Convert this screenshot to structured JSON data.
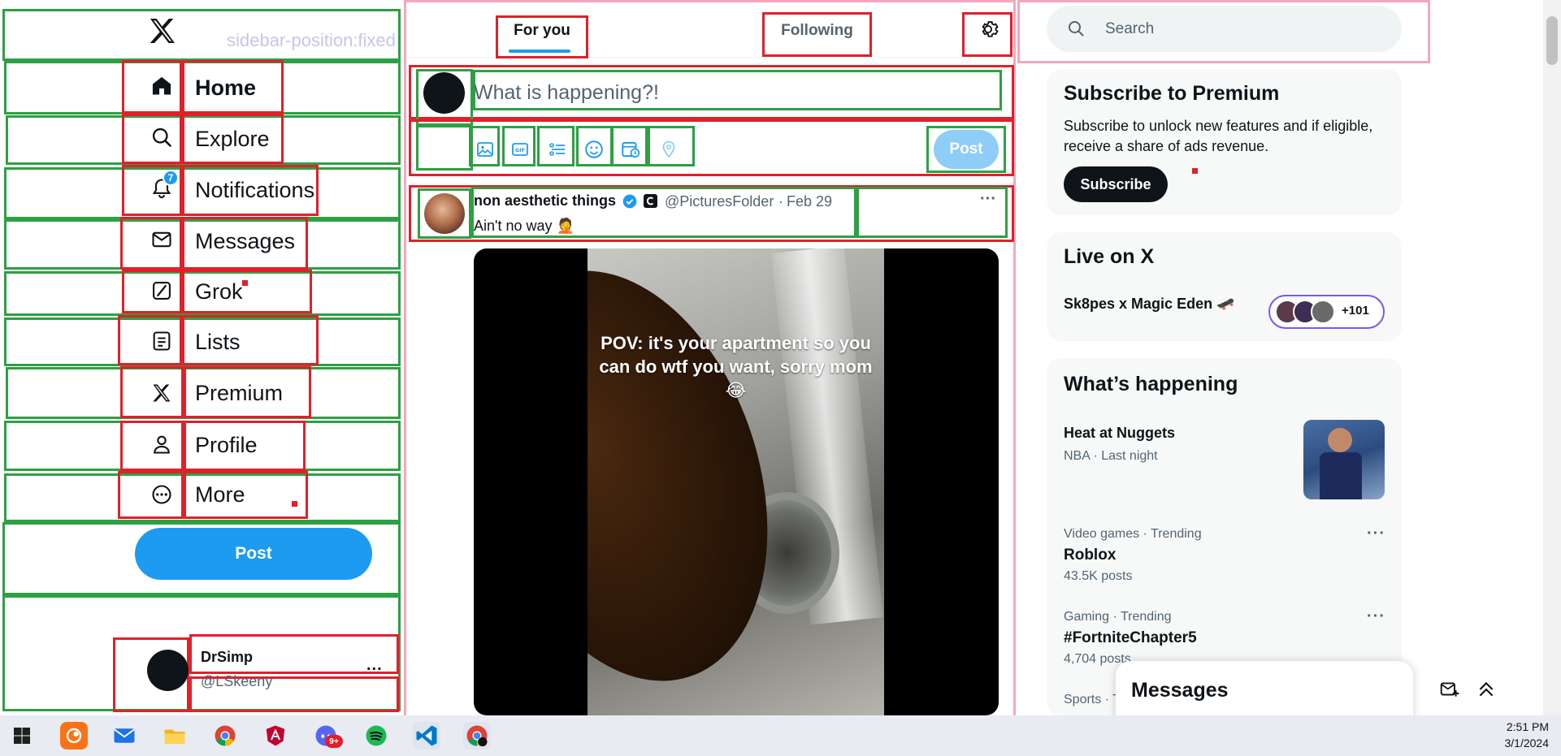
{
  "overlay": {
    "watermark": "sidebar-position:fixed"
  },
  "sidebar": {
    "items": [
      {
        "label": "Home",
        "icon": "home-icon"
      },
      {
        "label": "Explore",
        "icon": "search-icon"
      },
      {
        "label": "Notifications",
        "icon": "bell-icon",
        "badge": "7"
      },
      {
        "label": "Messages",
        "icon": "mail-icon"
      },
      {
        "label": "Grok",
        "icon": "grok-icon"
      },
      {
        "label": "Lists",
        "icon": "list-icon"
      },
      {
        "label": "Premium",
        "icon": "x-logo-icon"
      },
      {
        "label": "Profile",
        "icon": "person-icon"
      },
      {
        "label": "More",
        "icon": "more-circle-icon"
      }
    ],
    "post_label": "Post",
    "account": {
      "name": "DrSimp",
      "handle": "@LSkeeny",
      "more": "..."
    }
  },
  "feed": {
    "tabs": [
      {
        "label": "For you",
        "active": true
      },
      {
        "label": "Following",
        "active": false
      }
    ],
    "composer": {
      "placeholder": "What is happening?!",
      "post_label": "Post"
    },
    "tweet": {
      "author": "non aesthetic things",
      "handle": "@PicturesFolder",
      "date": "Feb 29",
      "separator": "·",
      "text": "Ain't no way 🤦",
      "more": "···",
      "media_caption": "POV: it's your apartment so you can do wtf you want, sorry mom 😂"
    }
  },
  "right": {
    "search_placeholder": "Search",
    "premium": {
      "title": "Subscribe to Premium",
      "text": "Subscribe to unlock new features and if eligible, receive a share of ads revenue.",
      "button": "Subscribe"
    },
    "live": {
      "title": "Live on X",
      "event": "Sk8pes x Magic Eden 🛹",
      "count": "+101"
    },
    "happening": {
      "title": "What’s happening",
      "items": [
        {
          "title": "Heat at Nuggets",
          "meta": "NBA · Last night"
        },
        {
          "meta": "Video games · Trending",
          "title": "Roblox",
          "posts": "43.5K posts"
        },
        {
          "meta": "Gaming · Trending",
          "title": "#FortniteChapter5",
          "posts": "4,704 posts"
        },
        {
          "meta": "Sports · T"
        }
      ]
    },
    "messages_drawer": {
      "title": "Messages"
    }
  },
  "taskbar": {
    "time": "2:51 PM",
    "date": "3/1/2024",
    "discord_badge": "9+"
  },
  "colors": {
    "accent": "#1d9bf0",
    "green_box": "#2ea043",
    "red_box": "#e0202a",
    "pink_box": "#f2a8bf"
  }
}
